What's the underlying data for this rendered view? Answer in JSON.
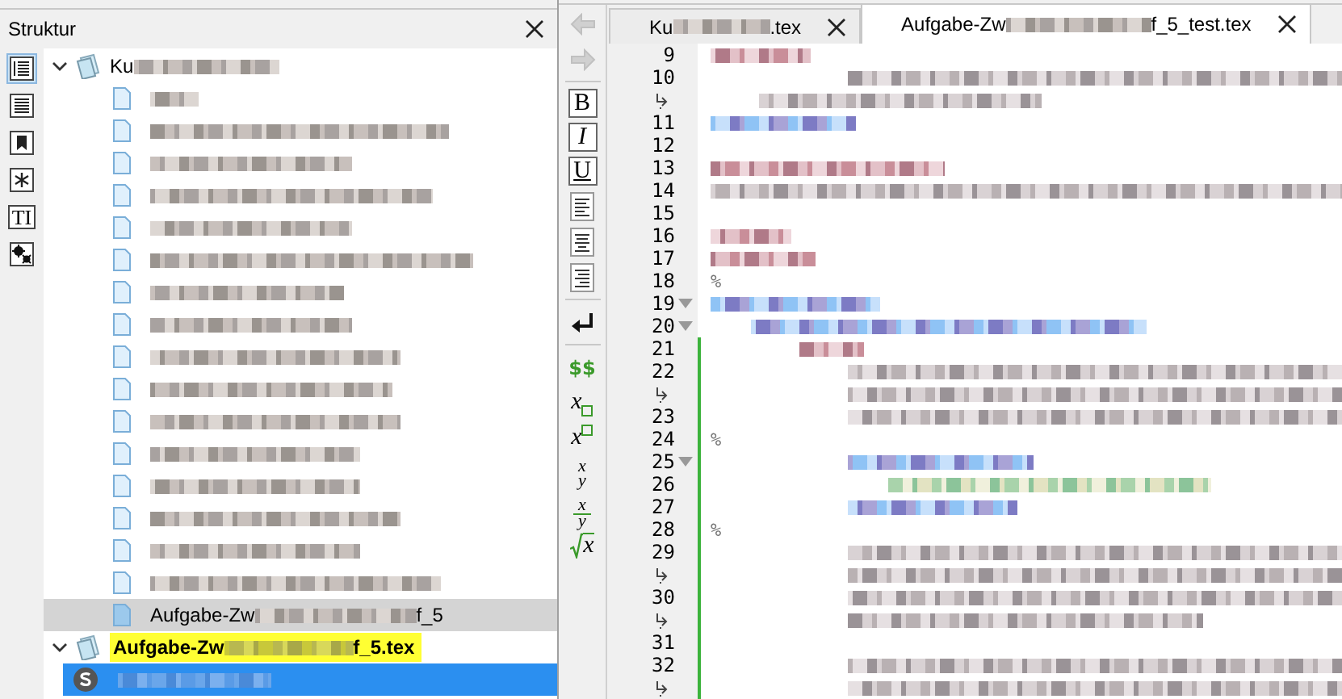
{
  "structure": {
    "title": "Struktur",
    "tools": [
      {
        "kind": "outline",
        "selected": true
      },
      {
        "kind": "lines",
        "selected": false
      },
      {
        "kind": "bookmark",
        "selected": false
      },
      {
        "kind": "asterisk",
        "selected": false
      },
      {
        "kind": "letters",
        "label": "TI",
        "selected": false
      },
      {
        "kind": "stars",
        "selected": false
      }
    ],
    "tree": [
      {
        "label_start": "Ku",
        "highlighted": false,
        "expanded": true,
        "children": [
          {
            "kind": "file",
            "selected": false
          },
          {
            "kind": "file",
            "selected": false
          },
          {
            "kind": "file",
            "selected": false
          },
          {
            "kind": "file",
            "selected": false
          },
          {
            "kind": "file",
            "selected": false
          },
          {
            "kind": "file",
            "selected": false
          },
          {
            "kind": "file",
            "selected": false
          },
          {
            "kind": "file",
            "selected": false
          },
          {
            "kind": "file",
            "selected": false
          },
          {
            "kind": "file",
            "selected": false
          },
          {
            "kind": "file",
            "selected": false
          },
          {
            "kind": "file",
            "selected": false
          },
          {
            "kind": "file",
            "selected": false
          },
          {
            "kind": "file",
            "selected": false
          },
          {
            "kind": "file",
            "selected": false
          },
          {
            "kind": "file",
            "selected": false
          },
          {
            "kind": "file",
            "label_start": "Aufgabe-Zw",
            "label_end": "f_5",
            "selected": true
          }
        ]
      },
      {
        "label_start": "Aufgabe-Zw",
        "label_end": "f_5.tex",
        "highlighted": true,
        "expanded": true,
        "children": [
          {
            "kind": "section",
            "selected": true
          }
        ]
      }
    ]
  },
  "editor": {
    "tabs": [
      {
        "label_start": "Ku",
        "label_end": ".tex",
        "selected": false
      },
      {
        "label_start": "Aufgabe-Zw",
        "label_end": "f_5_test.tex",
        "selected": true
      }
    ],
    "toolbar": [
      {
        "kind": "back",
        "disabled": true
      },
      {
        "kind": "forward",
        "disabled": true
      },
      {
        "kind": "sep"
      },
      {
        "kind": "bold",
        "label": "B"
      },
      {
        "kind": "italic",
        "label": "I"
      },
      {
        "kind": "underline",
        "label": "U"
      },
      {
        "kind": "align-left"
      },
      {
        "kind": "align-center"
      },
      {
        "kind": "align-right"
      },
      {
        "kind": "sep"
      },
      {
        "kind": "newline"
      },
      {
        "kind": "sep"
      },
      {
        "kind": "math",
        "label": "$$"
      },
      {
        "kind": "sub",
        "label": "x"
      },
      {
        "kind": "sup",
        "label": "x"
      },
      {
        "kind": "frac",
        "num": "x",
        "den": "y"
      },
      {
        "kind": "frac-line",
        "num": "x",
        "den": "y"
      },
      {
        "kind": "sqrt",
        "label": "x"
      }
    ],
    "lines": [
      {
        "number": "9",
        "kind": "macro",
        "changed": false
      },
      {
        "number": "10",
        "kind": "text",
        "changed": false
      },
      {
        "wrap": true,
        "kind": "text",
        "changed": false
      },
      {
        "number": "11",
        "kind": "env",
        "changed": false
      },
      {
        "number": "12",
        "kind": "blank",
        "changed": false
      },
      {
        "number": "13",
        "kind": "macro",
        "changed": false
      },
      {
        "number": "14",
        "kind": "text",
        "changed": false
      },
      {
        "number": "15",
        "kind": "blank",
        "changed": false
      },
      {
        "number": "16",
        "kind": "macro",
        "changed": false
      },
      {
        "number": "17",
        "kind": "macro",
        "changed": false
      },
      {
        "number": "18",
        "kind": "comment",
        "text": "%",
        "changed": false
      },
      {
        "number": "19",
        "kind": "env",
        "foldable": true,
        "changed": false
      },
      {
        "number": "20",
        "kind": "env",
        "foldable": true,
        "changed": false
      },
      {
        "number": "21",
        "kind": "macro",
        "changed": true
      },
      {
        "number": "22",
        "kind": "text",
        "changed": true
      },
      {
        "wrap": true,
        "kind": "text",
        "changed": true
      },
      {
        "number": "23",
        "kind": "text",
        "changed": true
      },
      {
        "number": "24",
        "kind": "comment",
        "text": "%",
        "changed": true
      },
      {
        "number": "25",
        "kind": "env",
        "foldable": true,
        "changed": true
      },
      {
        "number": "26",
        "kind": "math",
        "changed": true
      },
      {
        "number": "27",
        "kind": "env",
        "changed": true
      },
      {
        "number": "28",
        "kind": "comment",
        "text": "%",
        "changed": true
      },
      {
        "number": "29",
        "kind": "text",
        "changed": true
      },
      {
        "wrap": true,
        "kind": "text",
        "changed": true
      },
      {
        "number": "30",
        "kind": "text",
        "changed": true
      },
      {
        "wrap": true,
        "kind": "text",
        "changed": true
      },
      {
        "number": "31",
        "kind": "blank",
        "changed": true
      },
      {
        "number": "32",
        "kind": "text",
        "changed": true
      },
      {
        "wrap": true,
        "kind": "text",
        "changed": true
      }
    ]
  }
}
